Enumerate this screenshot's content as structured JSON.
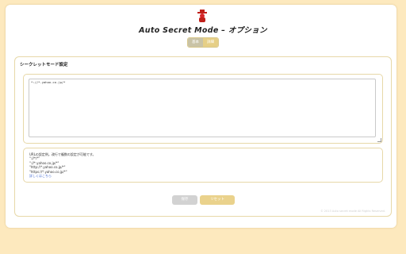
{
  "header": {
    "title": "Auto Secret Mode – オプション",
    "logo_icon": "red-secret-agent-icon"
  },
  "tabs": [
    {
      "label": "基本"
    },
    {
      "label": "詳細"
    }
  ],
  "section": {
    "title": "シークレットモード設定",
    "textarea_value": "*://*.yahoo.co.jp/*",
    "help_lines": [
      "URLの設定例。改行で複数の設定が可能です。",
      "\"://*/*\"",
      "\"://*.yahoo.co.jp/*\"",
      "\"http://*.yahoo.co.jp/*\"",
      "\"https://*.yahoo.co.jp/*\""
    ],
    "help_link": "詳しくはこちら"
  },
  "buttons": {
    "save": "保存",
    "reset": "リセット"
  },
  "footer": {
    "copyright": "© 2013 Auto secret mode All Rights Reserved."
  },
  "colors": {
    "background": "#fde9be",
    "accent": "#ead28c",
    "border": "#e7d8a8"
  }
}
